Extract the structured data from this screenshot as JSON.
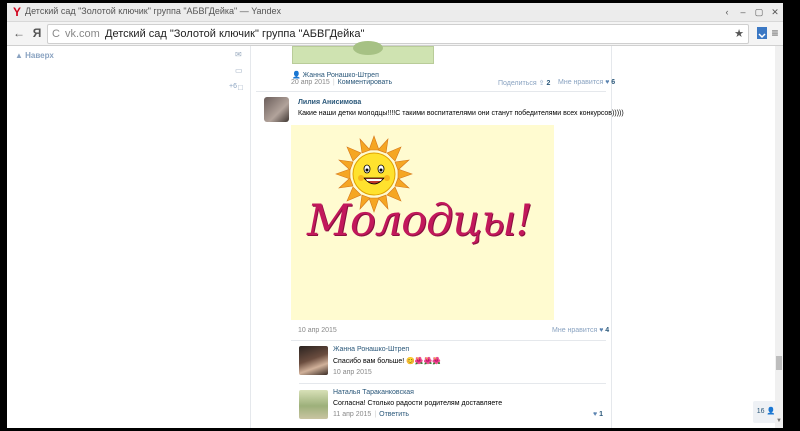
{
  "window": {
    "title": "Детский сад \"Золотой ключик\" группа \"АБВГДейка\" — Yandex",
    "buttons": [
      "‹",
      "–",
      "▢",
      "✕"
    ]
  },
  "toolbar": {
    "back": "←",
    "yandex": "Я",
    "reload": "C",
    "domain": "vk.com",
    "page_title": "Детский сад \"Золотой ключик\" группа \"АБВГДейка\"",
    "star": "★"
  },
  "left": {
    "back_label": "▲ Наверх",
    "counter": "+6"
  },
  "top_post": {
    "author": "Жанна Ронашко-Штреп",
    "date": "20 апр 2015",
    "comment": "Комментировать",
    "share_label": "Поделиться",
    "share_count": "2",
    "like_label": "Мне нравится",
    "like_count": "6"
  },
  "post": {
    "author": "Лилия Анисимова",
    "text": "Какие наши детки молодцы!!!!С такими воспитателями они станут победителями всех конкурсов)))))",
    "image_caption": "Молодцы!",
    "date": "10 апр 2015",
    "like_label": "Мне нравится",
    "like_count": "4"
  },
  "replies": [
    {
      "author": "Жанна Ронашко-Штреп",
      "text": "Спасибо вам больше! 😊🌺🌺🌺",
      "date": "10 апр 2015"
    },
    {
      "author": "Наталья Тараканковская",
      "text": "Согласна! Столько радости родителям доставляете",
      "date": "11 апр 2015",
      "reply_label": "Ответить",
      "like_count": "1"
    }
  ],
  "online_badge": "16",
  "colors": {
    "link": "#2b587a",
    "accent": "#5b84b1",
    "molodtsy": "#c2185b",
    "pic_bg": "#fffbd0"
  }
}
